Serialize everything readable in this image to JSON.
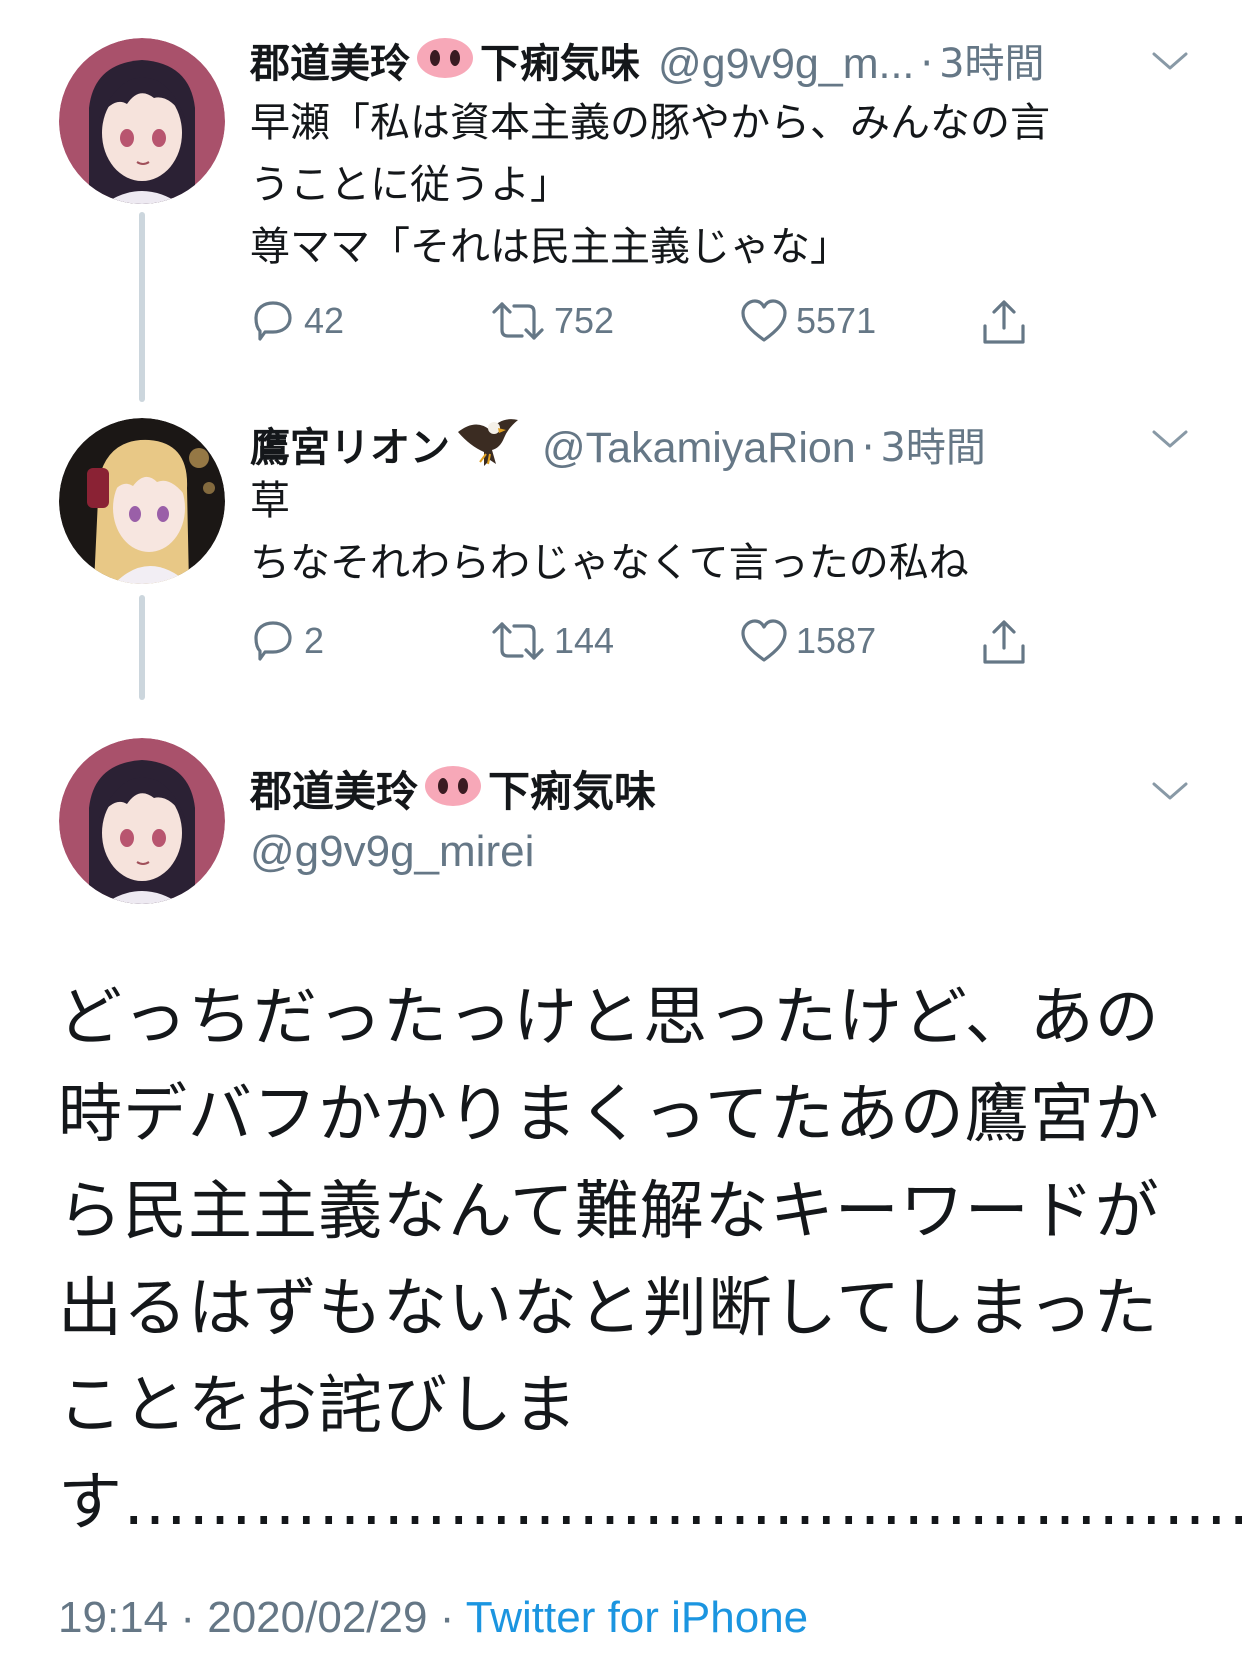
{
  "tweets": [
    {
      "display_name": "郡道美玲",
      "display_name_suffix": "下痢気味",
      "name_emoji": "pig-nose-icon",
      "handle": "@g9v9g_m...",
      "time": "3時間",
      "text": "早瀬「私は資本主義の豚やから、みんなの言\nうことに従うよ」\n尊ママ「それは民主主義じゃな」",
      "replies": "42",
      "retweets": "752",
      "likes": "5571"
    },
    {
      "display_name": "鷹宮リオン",
      "name_emoji": "eagle-icon",
      "handle": "@TakamiyaRion",
      "time": "3時間",
      "text": "草\nちなそれわらわじゃなくて言ったの私ね",
      "replies": "2",
      "retweets": "144",
      "likes": "1587"
    }
  ],
  "main_tweet": {
    "display_name": "郡道美玲",
    "display_name_suffix": "下痢気味",
    "name_emoji": "pig-nose-icon",
    "handle": "@g9v9g_mirei",
    "text": "どっちだったっけと思ったけど、あの\n時デバフかかりまくってたあの鷹宮か\nら民主主義なんて難解なキーワードが\n出るはずもないなと判断してしまった\nことをお詫びしま\nす………………………………………………",
    "time": "19:14",
    "date": "2020/02/29",
    "source": "Twitter for iPhone"
  },
  "colors": {
    "text": "#14171a",
    "secondary": "#657786",
    "link": "#1b95e0",
    "thread_line": "#ccd6dd"
  }
}
